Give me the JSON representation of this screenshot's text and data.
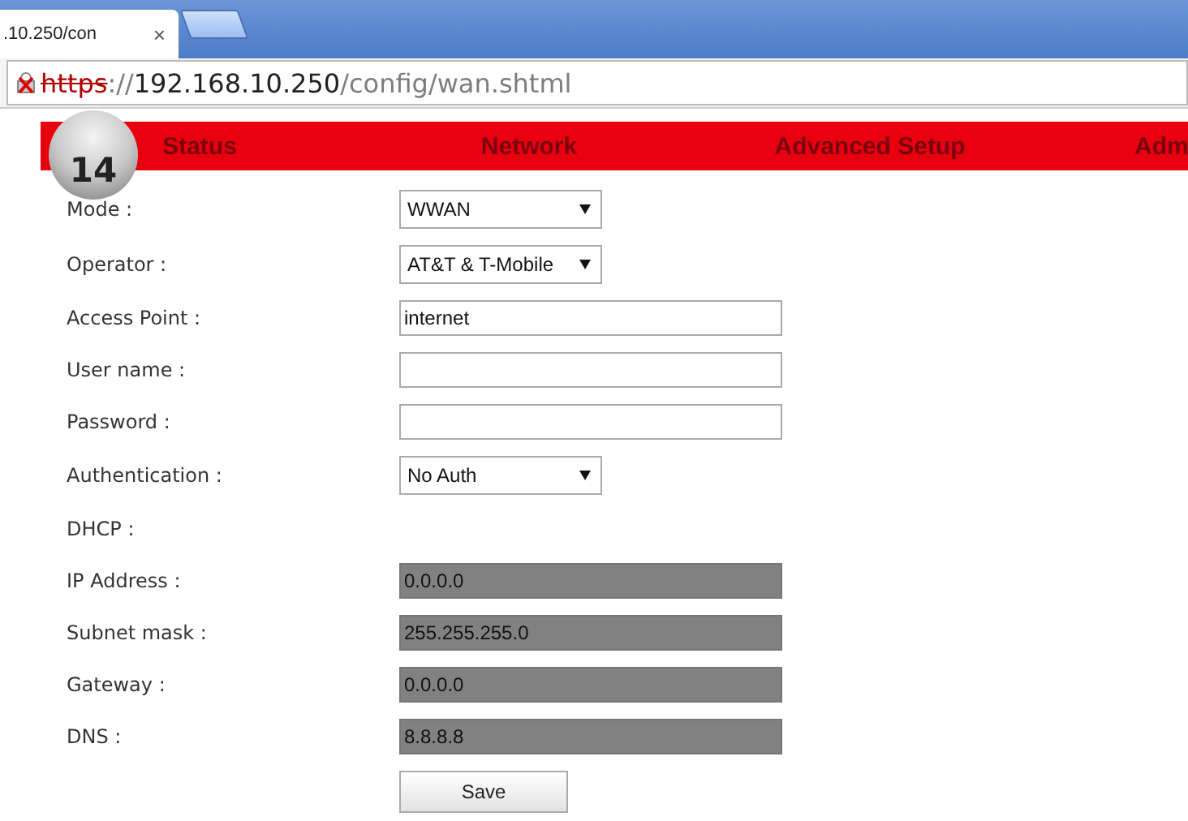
{
  "browser": {
    "tab": {
      "title": ".10.250/con",
      "close": "×"
    },
    "address": {
      "insecure": true,
      "scheme": "https",
      "separator": "://",
      "host": "192.168.10.250",
      "path": "/config/wan.shtml"
    }
  },
  "nav": [
    "Status",
    "Network",
    "Advanced Setup",
    "Adm"
  ],
  "step_badge": "14",
  "form": [
    {
      "label": "Mode :",
      "kind": "select",
      "value": "WWAN"
    },
    {
      "label": "Operator :",
      "kind": "select",
      "value": "AT&T & T-Mobile"
    },
    {
      "label": "Access Point :",
      "kind": "text",
      "value": "internet"
    },
    {
      "label": "User name :",
      "kind": "text"
    },
    {
      "label": "Password :",
      "kind": "text"
    },
    {
      "label": "Authentication :",
      "kind": "select",
      "value": "No Auth"
    },
    {
      "label": "DHCP :",
      "kind": "none"
    },
    {
      "label": "IP Address :",
      "kind": "disabled",
      "value": "0.0.0.0"
    },
    {
      "label": "Subnet mask :",
      "kind": "disabled",
      "value": "255.255.255.0"
    },
    {
      "label": "Gateway :",
      "kind": "disabled",
      "value": "0.0.0.0"
    },
    {
      "label": "DNS :",
      "kind": "disabled",
      "value": "8.8.8.8"
    }
  ],
  "save_button": "Save"
}
